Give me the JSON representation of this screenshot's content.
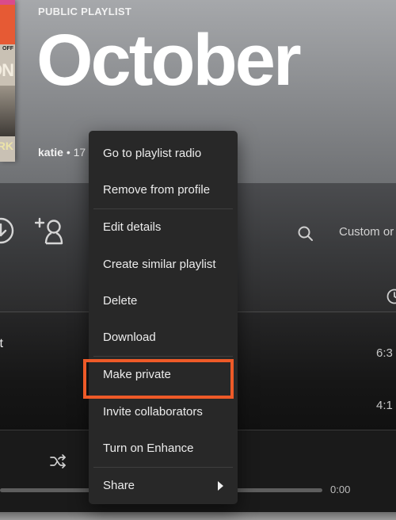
{
  "header": {
    "playlist_type": "PUBLIC PLAYLIST",
    "title": "October",
    "owner": "katie",
    "separator": "•",
    "song_count_partial": "17",
    "cover": {
      "text_top": "OFF",
      "text_mid": "ON",
      "text_bottom": "RK",
      "accent_color": "#e65a34"
    }
  },
  "toolbar": {
    "download_icon": "download-circle-icon",
    "add_user_icon": "add-user-icon",
    "search_icon": "search-icon",
    "sort_label": "Custom or"
  },
  "track_list": {
    "duration_header_icon": "clock-icon",
    "tracks": [
      {
        "title_partial": "it",
        "duration": "6:3"
      },
      {
        "title_partial": "",
        "duration": "4:1"
      }
    ]
  },
  "player": {
    "shuffle_icon": "shuffle-icon",
    "time_elapsed": "0:00",
    "progress_fraction": 0
  },
  "context_menu": {
    "items": [
      {
        "label": "Go to playlist radio"
      },
      {
        "label": "Remove from profile"
      },
      {
        "label": "Edit details"
      },
      {
        "label": "Create similar playlist"
      },
      {
        "label": "Delete"
      },
      {
        "label": "Download"
      },
      {
        "label": "Make private",
        "highlighted": true
      },
      {
        "label": "Invite collaborators"
      },
      {
        "label": "Turn on Enhance"
      },
      {
        "label": "Share",
        "has_submenu": true
      }
    ],
    "highlight_color": "#ee5a28"
  }
}
